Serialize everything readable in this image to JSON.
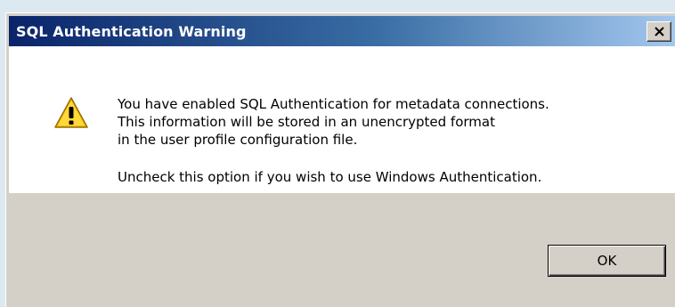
{
  "dialog": {
    "title": "SQL Authentication Warning",
    "close_icon": "close-icon",
    "warning_icon": "warning-icon",
    "message_lines": [
      "You have enabled SQL Authentication for metadata connections.",
      "This information will be stored in an unencrypted format",
      "in the user profile configuration file.",
      "Uncheck this option if you wish to use Windows Authentication."
    ],
    "ok_label": "OK"
  },
  "colors": {
    "titlebar_start": "#0a246a",
    "titlebar_end": "#a6caf0",
    "content_bg": "#ffffff",
    "face": "#d4d0c8",
    "warning_yellow": "#f5c400"
  }
}
